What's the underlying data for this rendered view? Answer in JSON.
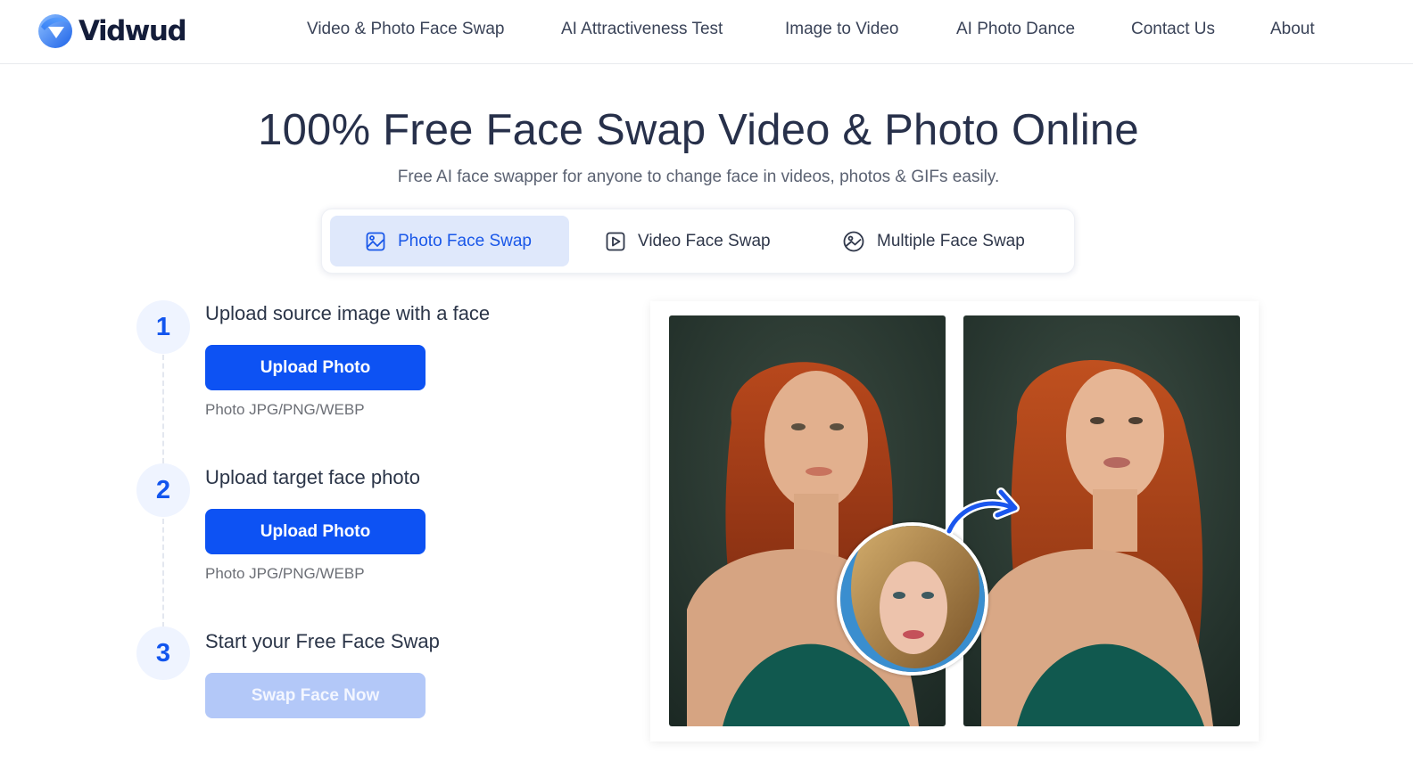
{
  "brand": {
    "name": "Vidwud",
    "logo_icon": "vidwud-logo-icon"
  },
  "nav": {
    "items": [
      {
        "label": "Video & Photo Face Swap"
      },
      {
        "label": "AI Attractiveness Test"
      },
      {
        "label": "Image to Video"
      },
      {
        "label": "AI Photo Dance"
      },
      {
        "label": "Contact Us"
      },
      {
        "label": "About"
      }
    ]
  },
  "hero": {
    "title": "100% Free Face Swap Video & Photo Online",
    "subtitle": "Free AI face swapper for anyone to change face in videos, photos & GIFs easily."
  },
  "tabs": [
    {
      "label": "Photo Face Swap",
      "icon": "image-icon",
      "active": true
    },
    {
      "label": "Video Face Swap",
      "icon": "play-square-icon",
      "active": false
    },
    {
      "label": "Multiple Face Swap",
      "icon": "image-circle-icon",
      "active": false
    }
  ],
  "steps": [
    {
      "number": "1",
      "title": "Upload source image with a face",
      "button": "Upload Photo",
      "hint": "Photo JPG/PNG/WEBP",
      "enabled": true
    },
    {
      "number": "2",
      "title": "Upload target face photo",
      "button": "Upload Photo",
      "hint": "Photo JPG/PNG/WEBP",
      "enabled": true
    },
    {
      "number": "3",
      "title": "Start your Free Face Swap",
      "button": "Swap Face Now",
      "enabled": false
    }
  ],
  "demo": {
    "images": [
      "original-photo",
      "target-face",
      "swapped-result"
    ]
  },
  "colors": {
    "primary": "#0d52f3",
    "primary_disabled": "#b3c8f8",
    "tab_active_bg": "#dfe8fb",
    "text_dark": "#27304a"
  }
}
